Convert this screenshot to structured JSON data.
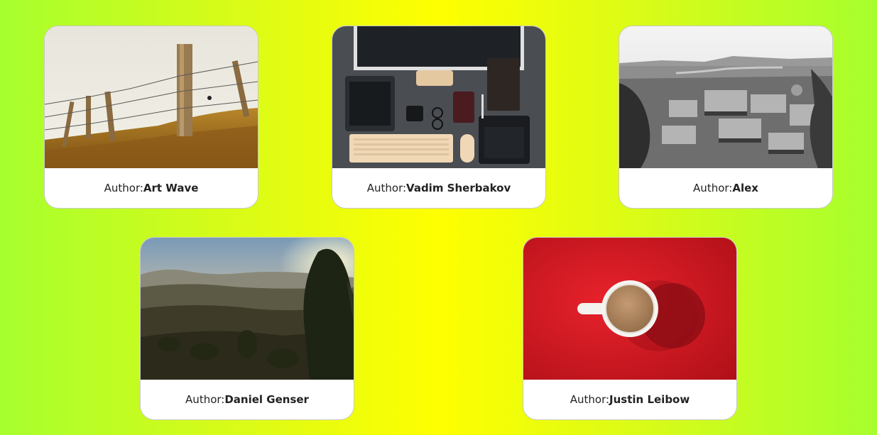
{
  "cards": [
    {
      "author_prefix": "Author:",
      "author_name": "Art Wave"
    },
    {
      "author_prefix": "Author:",
      "author_name": "Vadim Sherbakov"
    },
    {
      "author_prefix": "Author:",
      "author_name": "Alex"
    },
    {
      "author_prefix": "Author:",
      "author_name": "Daniel Genser"
    },
    {
      "author_prefix": "Author:",
      "author_name": "Justin Leibow"
    }
  ],
  "colors": {
    "background_edge": "#a6ff2e",
    "background_center": "#ffff00",
    "card": "#ffffff"
  }
}
